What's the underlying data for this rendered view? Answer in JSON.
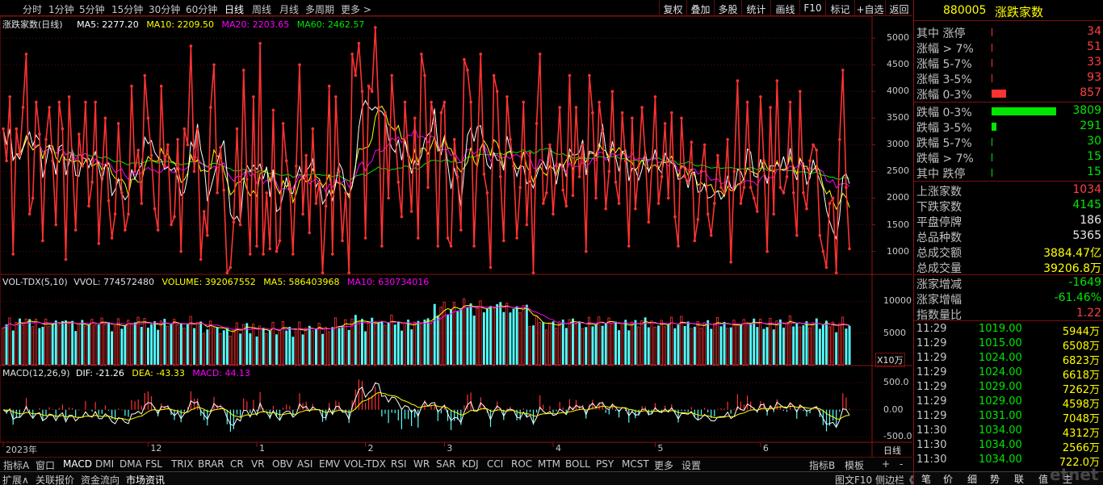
{
  "toolbar": {
    "periods": [
      "分时",
      "1分钟",
      "5分钟",
      "15分钟",
      "30分钟",
      "60分钟",
      "日线",
      "周线",
      "月线",
      "多周期",
      "更多 >"
    ],
    "active_period": "日线",
    "right_tools": [
      "复权",
      "叠加",
      "多股",
      "统计",
      "画线",
      "F10",
      "标记",
      "+自选",
      "返回"
    ]
  },
  "main_info": {
    "name": "涨跌家数(日线)",
    "ma5": "MA5: 2277.20",
    "ma10": "MA10: 2209.50",
    "ma20": "MA20: 2203.65",
    "ma60": "MA60: 2462.57"
  },
  "main_axis": [
    "5000",
    "4500",
    "4000",
    "3500",
    "3000",
    "2500",
    "2000",
    "1500",
    "1000"
  ],
  "vol_info": {
    "name": "VOL-TDX(5,10)",
    "vvol": "VVOL: 774572480",
    "volume": "VOLUME: 392067552",
    "ma5": "MA5: 586403968",
    "ma10": "MA10: 630734016"
  },
  "vol_axis": [
    "10000",
    "5000"
  ],
  "vol_unit": "X10万",
  "macd_info": {
    "name": "MACD(12,26,9)",
    "dif": "DIF: -21.26",
    "dea": "DEA: -43.33",
    "macd": "MACD: 44.13"
  },
  "macd_axis": [
    "500.0",
    "0.00",
    "-500.0"
  ],
  "date_axis": [
    "2023年",
    "12",
    "1",
    "2",
    "3",
    "4",
    "5",
    "6"
  ],
  "period_label": "日线",
  "colors": {
    "up": "#ff3232",
    "down": "#54ffff",
    "ma5": "#ffffff",
    "ma10": "#ffff00",
    "ma20": "#ff00ff",
    "ma60": "#00e600"
  },
  "chart_data": {
    "type": "line",
    "title": "涨跌家数(日线)",
    "series": [
      {
        "name": "涨跌家数",
        "values": [
          3300,
          2700,
          3900,
          950,
          3300,
          2800,
          3700,
          4700,
          1700,
          2000,
          3800,
          3200,
          1200,
          3100,
          3700,
          2700,
          1500,
          3800,
          3300,
          850,
          3900,
          2700,
          1400,
          3200,
          2600,
          3800,
          1850,
          2300,
          3800,
          1150,
          2400,
          3500,
          1950,
          1250,
          1700,
          3400,
          2100,
          1400,
          1700,
          4100,
          2500,
          2900,
          1900,
          4300,
          3500,
          2800,
          1800,
          1400,
          4100,
          2600,
          3000,
          1500,
          1650,
          3100,
          1000,
          3300,
          3000,
          4850,
          2500,
          3300,
          850,
          1750,
          1300,
          3700,
          4500,
          2100,
          2950,
          2150,
          600,
          700,
          1550,
          3300,
          1500,
          4400,
          2350,
          950,
          3900,
          1100,
          4900,
          950,
          2100,
          1050,
          3650,
          1000,
          1200,
          3400,
          2700,
          2200,
          950,
          2600,
          4500,
          1700,
          2800,
          1350,
          3300,
          1900,
          2300,
          600,
          1850,
          4100,
          950,
          3900,
          2500,
          1200,
          2100,
          600,
          4700,
          4300,
          4900,
          4000,
          1250,
          4100,
          4000,
          5200,
          3700,
          1100,
          3600,
          2000,
          4300,
          3300,
          2300,
          1650,
          3800,
          2800,
          1750,
          3500,
          1250,
          4700,
          4300,
          2200,
          3800,
          3400,
          1100,
          3600,
          3800,
          1250,
          1100,
          3100,
          2400,
          1400,
          4600,
          4400,
          3800,
          1100,
          2800,
          4700,
          2450,
          2100,
          700,
          4300,
          4000,
          2400,
          1200,
          3900,
          3100,
          2600,
          1250,
          2200,
          3800,
          1500,
          2850,
          600,
          3400,
          4700,
          1900,
          2100,
          3000,
          1700,
          2600,
          3700,
          2150,
          1850,
          4300,
          2050,
          3700,
          2400,
          3000,
          1000,
          4300,
          3600,
          2000,
          3800,
          3250,
          1800,
          2500,
          4000,
          2300,
          1900,
          3600,
          2700,
          1100,
          3500,
          1800,
          2600,
          3700,
          2800,
          1550,
          2600,
          3900,
          1900,
          2400,
          3400,
          2000,
          3600,
          1650,
          1100,
          3500,
          2400,
          2300,
          3050,
          1200,
          1600,
          2500,
          3000,
          1700,
          1300,
          1900,
          2800,
          2200,
          2100,
          3100,
          800,
          2500,
          4200,
          1900,
          2200,
          3800,
          2200,
          2000,
          1750,
          3900,
          2700,
          1000,
          3700,
          1700,
          4200,
          2200,
          2100,
          2400,
          3800,
          2100,
          1300,
          4000,
          2100,
          1800,
          2700,
          3000,
          2900,
          1300,
          1000,
          700,
          1900,
          2000,
          600,
          3100,
          4400,
          2200,
          1050
        ]
      }
    ],
    "ylim": [
      600,
      5200
    ],
    "volume": {
      "unit": "X10万",
      "ylim": [
        0,
        14000
      ],
      "ma5": 5864,
      "ma10": 6307
    },
    "macd": {
      "ylim": [
        -600,
        800
      ],
      "dif": -21.26,
      "dea": -43.33,
      "macd": 44.13
    }
  },
  "right_panel": {
    "code": "880005",
    "name": "涨跌家数",
    "dist_up": [
      {
        "label": "其中 涨停",
        "value": "34",
        "frac": 0.01
      },
      {
        "label": "涨幅 > 7%",
        "value": "51",
        "frac": 0.01
      },
      {
        "label": "涨幅 5-7%",
        "value": "33",
        "frac": 0.01
      },
      {
        "label": "涨幅 3-5%",
        "value": "93",
        "frac": 0.01
      },
      {
        "label": "涨幅 0-3%",
        "value": "857",
        "frac": 0.22
      }
    ],
    "dist_down": [
      {
        "label": "跌幅 0-3%",
        "value": "3809",
        "frac": 1.0
      },
      {
        "label": "跌幅 3-5%",
        "value": "291",
        "frac": 0.08
      },
      {
        "label": "跌幅 5-7%",
        "value": "30",
        "frac": 0.01
      },
      {
        "label": "跌幅 > 7%",
        "value": "15",
        "frac": 0.01
      },
      {
        "label": "其中 跌停",
        "value": "15",
        "frac": 0.01
      }
    ],
    "stats": [
      {
        "label": "上涨家数",
        "value": "1034",
        "color": "red"
      },
      {
        "label": "下跌家数",
        "value": "4145",
        "color": "grn"
      },
      {
        "label": "平盘停牌",
        "value": "186",
        "color": "wht"
      },
      {
        "label": "总品种数",
        "value": "5365",
        "color": "wht"
      },
      {
        "label": "总成交额",
        "value": "3884.47亿",
        "color": "yel"
      },
      {
        "label": "总成交量",
        "value": "39206.8万",
        "color": "yel"
      }
    ],
    "stats2": [
      {
        "label": "涨家增减",
        "value": "-1649",
        "color": "grn"
      },
      {
        "label": "涨家增幅",
        "value": "-61.46%",
        "color": "grn"
      },
      {
        "label": "指数量比",
        "value": "1.22",
        "color": "red"
      }
    ],
    "ticks": [
      {
        "time": "11:29",
        "price": "1019.00",
        "vol": "5944万"
      },
      {
        "time": "11:29",
        "price": "1015.00",
        "vol": "6508万"
      },
      {
        "time": "11:29",
        "price": "1024.00",
        "vol": "6823万"
      },
      {
        "time": "11:29",
        "price": "1024.00",
        "vol": "6618万"
      },
      {
        "time": "11:29",
        "price": "1029.00",
        "vol": "7262万"
      },
      {
        "time": "11:29",
        "price": "1029.00",
        "vol": "4598万"
      },
      {
        "time": "11:29",
        "price": "1031.00",
        "vol": "7048万"
      },
      {
        "time": "11:30",
        "price": "1034.00",
        "vol": "4312万"
      },
      {
        "time": "11:30",
        "price": "1034.00",
        "vol": "2566万"
      },
      {
        "time": "11:30",
        "price": "1034.00",
        "vol": "722.0万"
      }
    ]
  },
  "indicator_tabs": [
    "指标A",
    "窗口",
    "MACD",
    "DMI",
    "DMA",
    "FSL",
    "TRIX",
    "BRAR",
    "CR",
    "VR",
    "OBV",
    "ASI",
    "EMV",
    "VOL-TDX",
    "RSI",
    "WR",
    "SAR",
    "KDJ",
    "CCI",
    "ROC",
    "MTM",
    "BOLL",
    "PSY",
    "MCST",
    "更多",
    "设置"
  ],
  "indicator_right": [
    "指标B",
    "模板",
    "+",
    "-"
  ],
  "status_left": [
    "扩展∧",
    "关联报价",
    "资金流向",
    "市场资讯"
  ],
  "status_right": "图文F10 侧边栏《",
  "right_bottom_tabs": [
    "笔",
    "价",
    "细",
    "势",
    "联",
    "值",
    "主"
  ],
  "watermark": "etnet"
}
